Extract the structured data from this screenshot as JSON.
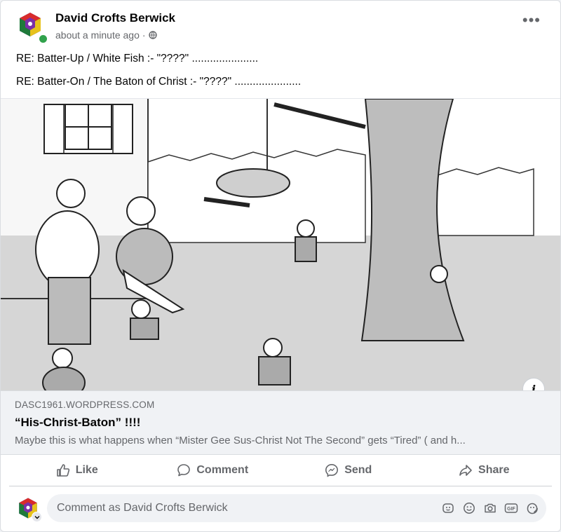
{
  "post": {
    "author": "David Crofts Berwick",
    "time": "about a minute ago",
    "separator": "·",
    "privacy_icon": "globe-icon",
    "more_label": "•••",
    "lines": [
      "RE: Batter-Up / White Fish :- \"????\" ......................",
      "RE: Batter-On / The Baton of Christ :- \"????\" ......................"
    ]
  },
  "image": {
    "alt_icon": "info-icon",
    "info_label": "i"
  },
  "link_preview": {
    "domain": "DASC1961.WORDPRESS.COM",
    "title": "“His-Christ-Baton” !!!!",
    "description": "Maybe this is what happens when “Mister Gee Sus-Christ Not The Second” gets “Tired” ( and h..."
  },
  "actions": [
    {
      "label": "Like",
      "icon": "thumbs-up-icon"
    },
    {
      "label": "Comment",
      "icon": "speech-bubble-icon"
    },
    {
      "label": "Send",
      "icon": "messenger-icon"
    },
    {
      "label": "Share",
      "icon": "share-arrow-icon"
    }
  ],
  "comment_box": {
    "placeholder": "Comment as David Crofts Berwick",
    "icons": [
      "avatar-sticker-icon",
      "emoji-icon",
      "camera-icon",
      "gif-icon",
      "sticker-icon"
    ],
    "gif_label": "GIF"
  },
  "colors": {
    "online": "#31a24c",
    "muted": "#65676b",
    "bg_light": "#f0f2f5"
  }
}
